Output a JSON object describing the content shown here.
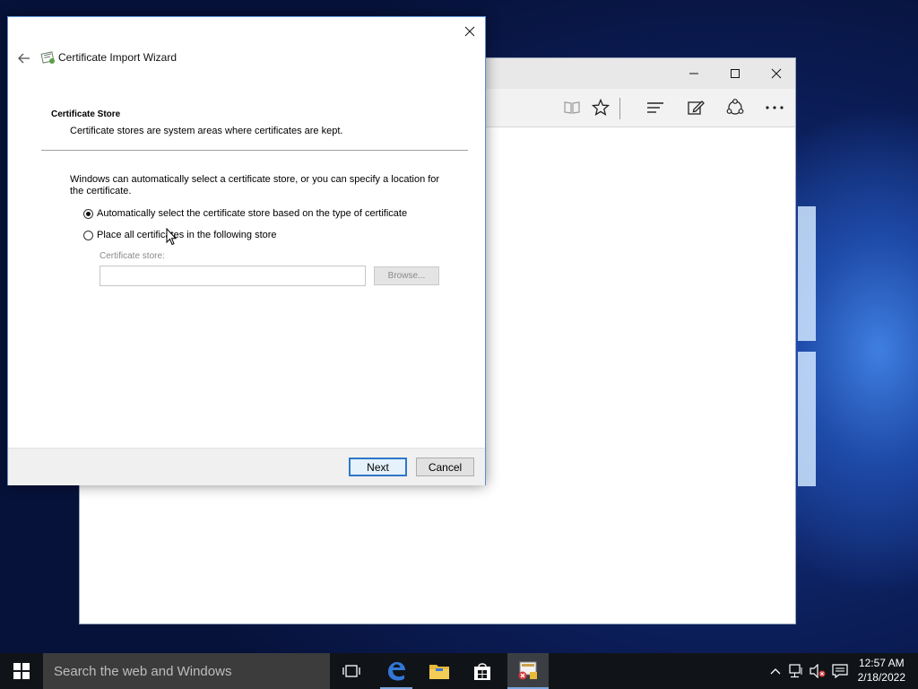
{
  "dialog": {
    "title": "Certificate Import Wizard",
    "section_title": "Certificate Store",
    "section_description": "Certificate stores are system areas where certificates are kept.",
    "intro_text": "Windows can automatically select a certificate store, or you can specify a location for the certificate.",
    "options": [
      {
        "label": "Automatically select the certificate store based on the type of certificate",
        "selected": true
      },
      {
        "label": "Place all certificates in the following store",
        "selected": false
      }
    ],
    "store_label": "Certificate store:",
    "store_value": "",
    "browse_label": "Browse...",
    "next_label": "Next",
    "cancel_label": "Cancel"
  },
  "browser": {
    "toolbar_icons": [
      "reading-view-icon",
      "favorites-star-icon",
      "hub-icon",
      "web-note-icon",
      "share-icon",
      "more-icon"
    ]
  },
  "taskbar": {
    "search_placeholder": "Search the web and Windows",
    "time": "12:57 AM",
    "date": "2/18/2022"
  },
  "colors": {
    "accent": "#2f77c9",
    "taskbar": "#101418",
    "search_box": "#3c3c3c"
  }
}
